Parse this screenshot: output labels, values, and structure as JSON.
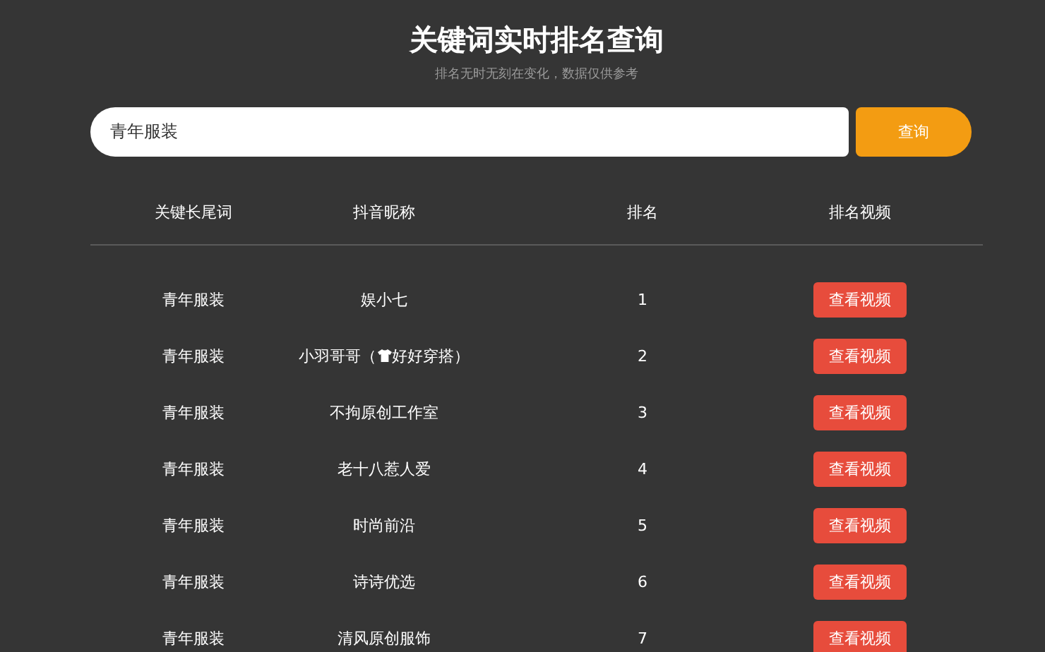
{
  "title": "关键词实时排名查询",
  "subtitle": "排名无时无刻在变化，数据仅供参考",
  "search": {
    "value": "青年服装",
    "button": "查询"
  },
  "table": {
    "columns": [
      "关键长尾词",
      "抖音昵称",
      "排名",
      "排名视频"
    ],
    "rows": [
      {
        "keyword": "青年服装",
        "nickname": "娱小七",
        "rank": "1",
        "button": "查看视频"
      },
      {
        "keyword": "青年服装",
        "nickname": "小羽哥哥（",
        "nickname_after": "好好穿搭）",
        "rank": "2",
        "button": "查看视频"
      },
      {
        "keyword": "青年服装",
        "nickname": "不拘原创工作室",
        "rank": "3",
        "button": "查看视频"
      },
      {
        "keyword": "青年服装",
        "nickname": "老十八惹人爱",
        "rank": "4",
        "button": "查看视频"
      },
      {
        "keyword": "青年服装",
        "nickname": "时尚前沿",
        "rank": "5",
        "button": "查看视频"
      },
      {
        "keyword": "青年服装",
        "nickname": "诗诗优选",
        "rank": "6",
        "button": "查看视频"
      },
      {
        "keyword": "青年服装",
        "nickname": "清风原创服饰",
        "rank": "7",
        "button": "查看视频"
      }
    ]
  }
}
